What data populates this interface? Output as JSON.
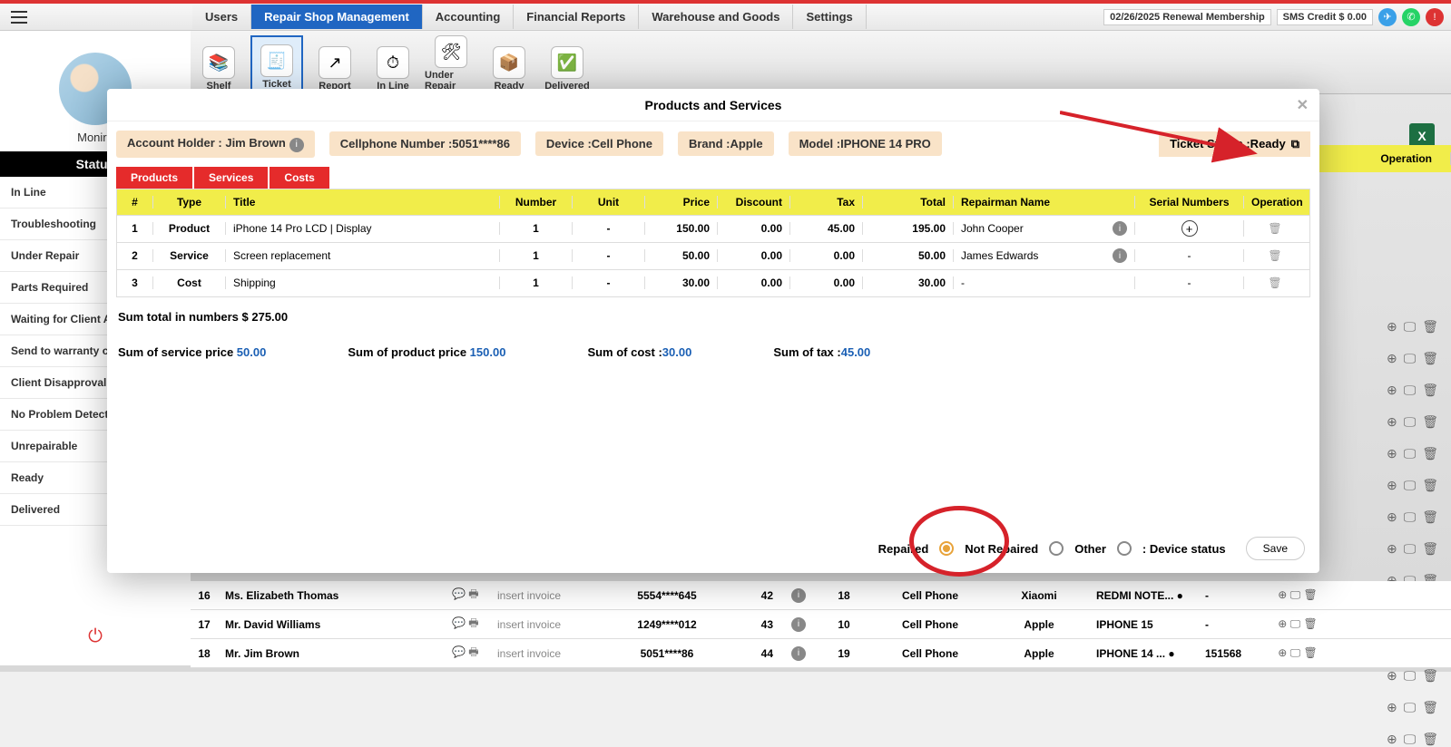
{
  "topbar": {
    "date": "02/26/2025 Renewal Membership",
    "sms": "SMS Credit $ 0.00"
  },
  "tabs": [
    "Users",
    "Repair Shop Management",
    "Accounting",
    "Financial Reports",
    "Warehouse and Goods",
    "Settings"
  ],
  "ribbon": [
    {
      "l": "Shelf",
      "i": "📚"
    },
    {
      "l": "Ticket",
      "i": "🧾"
    },
    {
      "l": "Report",
      "i": "↗"
    },
    {
      "l": "In Line",
      "i": "⏱"
    },
    {
      "l": "Under Repair",
      "i": "🛠"
    },
    {
      "l": "Ready",
      "i": "📦"
    },
    {
      "l": "Delivered",
      "i": "✅"
    }
  ],
  "user": "Monire",
  "statusHdr": "Status",
  "statuses": [
    "In Line",
    "Troubleshooting",
    "Under Repair",
    "Parts Required",
    "Waiting for Client A",
    "Send to warranty c",
    "Client Disapproval",
    "No Problem Detect",
    "Unrepairable",
    "Ready",
    "Delivered"
  ],
  "bghdr": {
    "op": "Operation"
  },
  "bgrows": [
    {
      "n": "16",
      "nm": "Ms. Elizabeth Thomas",
      "inv": "insert invoice",
      "ph": "5554****645",
      "a": "42",
      "b": "18",
      "dv": "Cell Phone",
      "br": "Xiaomi",
      "md": "REDMI NOTE... ●",
      "sn": "-"
    },
    {
      "n": "17",
      "nm": "Mr. David Williams",
      "inv": "insert invoice",
      "ph": "1249****012",
      "a": "43",
      "b": "10",
      "dv": "Cell Phone",
      "br": "Apple",
      "md": "IPHONE 15",
      "sn": "-"
    },
    {
      "n": "18",
      "nm": "Mr. Jim Brown",
      "inv": "insert invoice",
      "ph": "5051****86",
      "a": "44",
      "b": "19",
      "dv": "Cell Phone",
      "br": "Apple",
      "md": "IPHONE 14 ... ●",
      "sn": "151568"
    }
  ],
  "modal": {
    "title": "Products and Services",
    "info": {
      "holder": "Account Holder : Jim Brown",
      "cell": "Cellphone Number :5051****86",
      "device": "Device :Cell Phone",
      "brand": "Brand :Apple",
      "model": "Model :IPHONE 14 PRO",
      "status": "Ticket Status :Ready"
    },
    "mtabs": [
      "Products",
      "Services",
      "Costs"
    ],
    "cols": [
      "#",
      "Type",
      "Title",
      "Number",
      "Unit",
      "Price",
      "Discount",
      "Tax",
      "Total",
      "Repairman Name",
      "Serial Numbers",
      "Operation"
    ],
    "rows": [
      {
        "n": "1",
        "ty": "Product",
        "ti": "iPhone 14 Pro LCD | Display",
        "nu": "1",
        "un": "-",
        "pr": "150.00",
        "di": "0.00",
        "tx": "45.00",
        "to": "195.00",
        "rm": "John Cooper",
        "sn": "add",
        "info": true
      },
      {
        "n": "2",
        "ty": "Service",
        "ti": "Screen replacement",
        "nu": "1",
        "un": "-",
        "pr": "50.00",
        "di": "0.00",
        "tx": "0.00",
        "to": "50.00",
        "rm": "James Edwards",
        "sn": "-",
        "info": true
      },
      {
        "n": "3",
        "ty": "Cost",
        "ti": "Shipping",
        "nu": "1",
        "un": "-",
        "pr": "30.00",
        "di": "0.00",
        "tx": "0.00",
        "to": "30.00",
        "rm": "-",
        "sn": "-",
        "info": false
      }
    ],
    "sumTotal": "Sum total in numbers $ 275.00",
    "sums": {
      "svc": {
        "l": "Sum of service price ",
        "v": "50.00"
      },
      "prd": {
        "l": "Sum of product price ",
        "v": "150.00"
      },
      "cost": {
        "l": "Sum of cost :",
        "v": "30.00"
      },
      "tax": {
        "l": "Sum of tax :",
        "v": "45.00"
      }
    },
    "foot": {
      "r1": "Repaired",
      "r2": "Not Repaired",
      "r3": "Other",
      "ds": ": Device status",
      "save": "Save"
    }
  }
}
